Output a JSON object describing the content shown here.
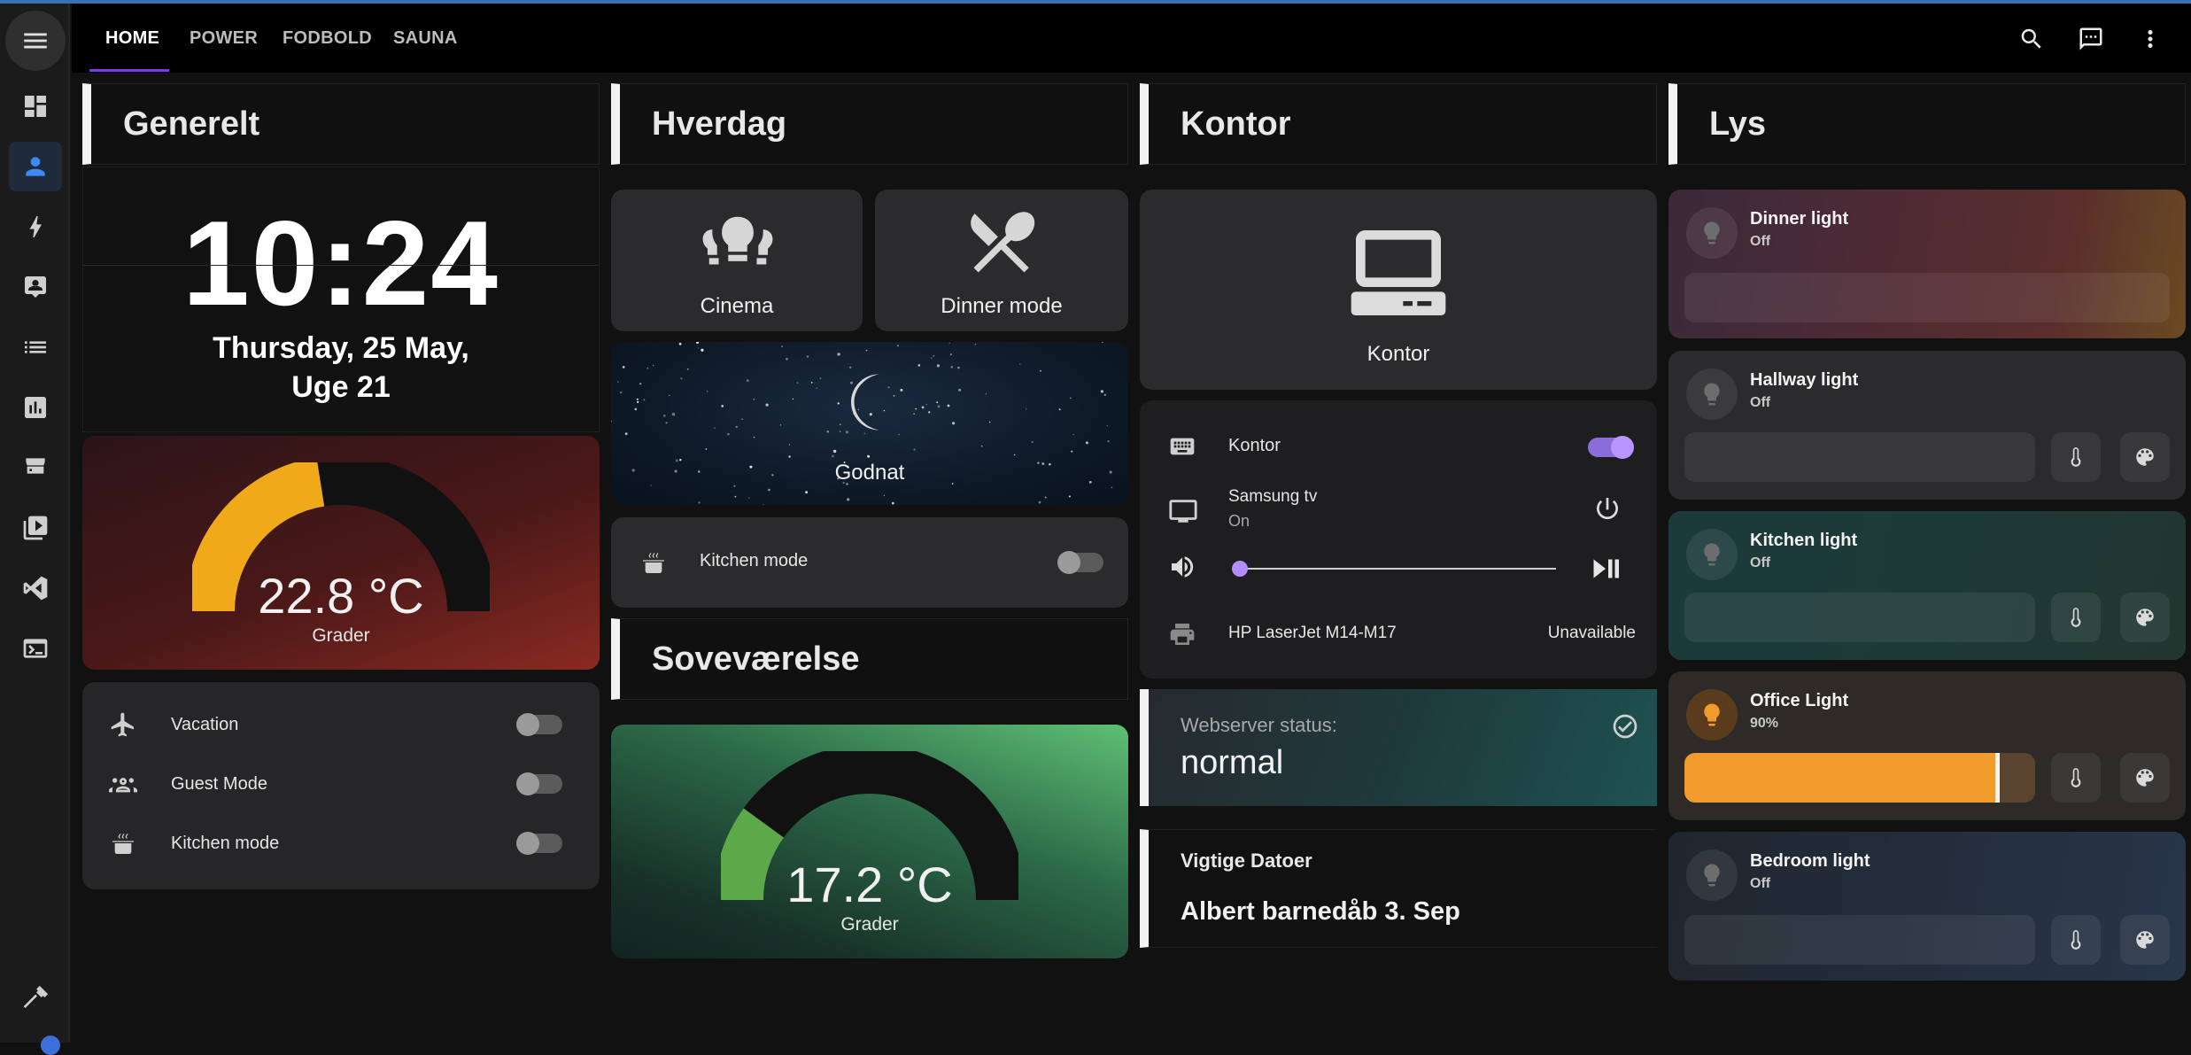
{
  "header": {
    "tabs": [
      {
        "label": "HOME"
      },
      {
        "label": "POWER"
      },
      {
        "label": "FODBOLD"
      },
      {
        "label": "SAUNA"
      }
    ]
  },
  "sidebar": {
    "items": [
      "dashboard-icon",
      "person-icon",
      "lightning-icon",
      "account-box-icon",
      "list-icon",
      "chart-icon",
      "hacs-icon",
      "media-icon",
      "vscode-icon",
      "terminal-icon"
    ],
    "bottom": "hammer-icon"
  },
  "generelt": {
    "title": "Generelt",
    "clock": {
      "time": "10:24",
      "date_line1": "Thursday, 25 May,",
      "date_line2": "Uge 21"
    },
    "gauge": {
      "value": "22.8 °C",
      "label": "Grader",
      "level": 0.45,
      "color": "#f0aa19"
    },
    "toggles": [
      {
        "label": "Vacation",
        "icon": "airplane-icon",
        "on": false
      },
      {
        "label": "Guest Mode",
        "icon": "people-icon",
        "on": false
      },
      {
        "label": "Kitchen mode",
        "icon": "pot-icon",
        "on": false
      }
    ]
  },
  "hverdag": {
    "title": "Hverdag",
    "buttons": [
      {
        "label": "Cinema",
        "icon": "theater-icon"
      },
      {
        "label": "Dinner mode",
        "icon": "silverware-icon"
      }
    ],
    "godnat": {
      "label": "Godnat",
      "icon": "moon-icon"
    },
    "kitchen": {
      "label": "Kitchen mode",
      "on": false
    }
  },
  "sovevaerelse": {
    "title": "Soveværelse",
    "gauge": {
      "value": "17.2 °C",
      "label": "Grader",
      "level": 0.2,
      "color": "#5da94a"
    }
  },
  "kontor": {
    "title": "Kontor",
    "button": {
      "label": "Kontor",
      "icon": "desktop-icon"
    },
    "entities": {
      "kontor_label": "Kontor",
      "tv_label": "Samsung tv",
      "tv_state": "On",
      "printer_label": "HP LaserJet M14-M17",
      "printer_state": "Unavailable",
      "volume_level": 0.0
    },
    "webserver": {
      "label": "Webserver status:",
      "value": "normal"
    },
    "datoer": {
      "title": "Vigtige Datoer",
      "value": "Albert barnedåb 3. Sep"
    }
  },
  "lys": {
    "title": "Lys",
    "lights": [
      {
        "name": "Dinner light",
        "state": "Off",
        "brightness": 0
      },
      {
        "name": "Hallway light",
        "state": "Off",
        "brightness": 0
      },
      {
        "name": "Kitchen light",
        "state": "Off",
        "brightness": 0
      },
      {
        "name": "Office Light",
        "state": "90%",
        "brightness": 0.9,
        "color": "#f19b2c"
      },
      {
        "name": "Bedroom light",
        "state": "Off",
        "brightness": 0
      }
    ]
  },
  "colors": {
    "accent": "#7c3aed",
    "sidebar_active": "#3d8af7",
    "toggle_on": "#b895ff"
  }
}
